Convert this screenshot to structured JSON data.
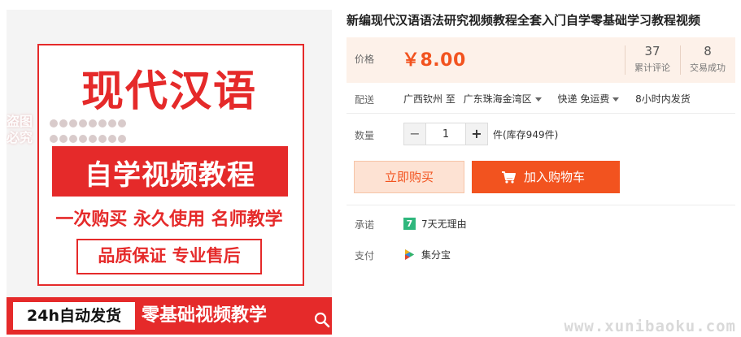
{
  "product_image": {
    "title": "现代汉语",
    "subtitle": "自学视频教程",
    "slogan": "一次购买 永久使用 名师教学",
    "guarantee": "品质保证 专业售后",
    "bottom_badge": "24h自动发货",
    "bottom_text": "零基础视频教学",
    "stamp_line1": "盗图",
    "stamp_line2": "必究",
    "zoom_icon": "magnifier-icon"
  },
  "product": {
    "title": "新编现代汉语语法研究视频教程全套入门自学零基础学习教程视频"
  },
  "price": {
    "label": "价格",
    "value": "￥8.00",
    "reviews_count": "37",
    "reviews_label": "累计评论",
    "sales_count": "8",
    "sales_label": "交易成功"
  },
  "shipping": {
    "label": "配送",
    "from": "广西钦州 至",
    "to": "广东珠海金湾区",
    "method": "快递 免运费",
    "dispatch": "8小时内发货"
  },
  "quantity": {
    "label": "数量",
    "value": "1",
    "minus": "−",
    "plus": "+",
    "stock": "件(库存949件)"
  },
  "actions": {
    "buy_now": "立即购买",
    "add_to_cart": "加入购物车"
  },
  "promise": {
    "label": "承诺",
    "icon_text": "7",
    "text": "7天无理由"
  },
  "payment": {
    "label": "支付",
    "text": "集分宝"
  },
  "site_watermark": "www.xunibaoku.com",
  "colors": {
    "accent": "#f2531f",
    "brand_red": "#e52a2a",
    "price_bg": "#fdf1e9",
    "buy_now_bg": "#fde2d3",
    "promise_green": "#2fb77d"
  }
}
